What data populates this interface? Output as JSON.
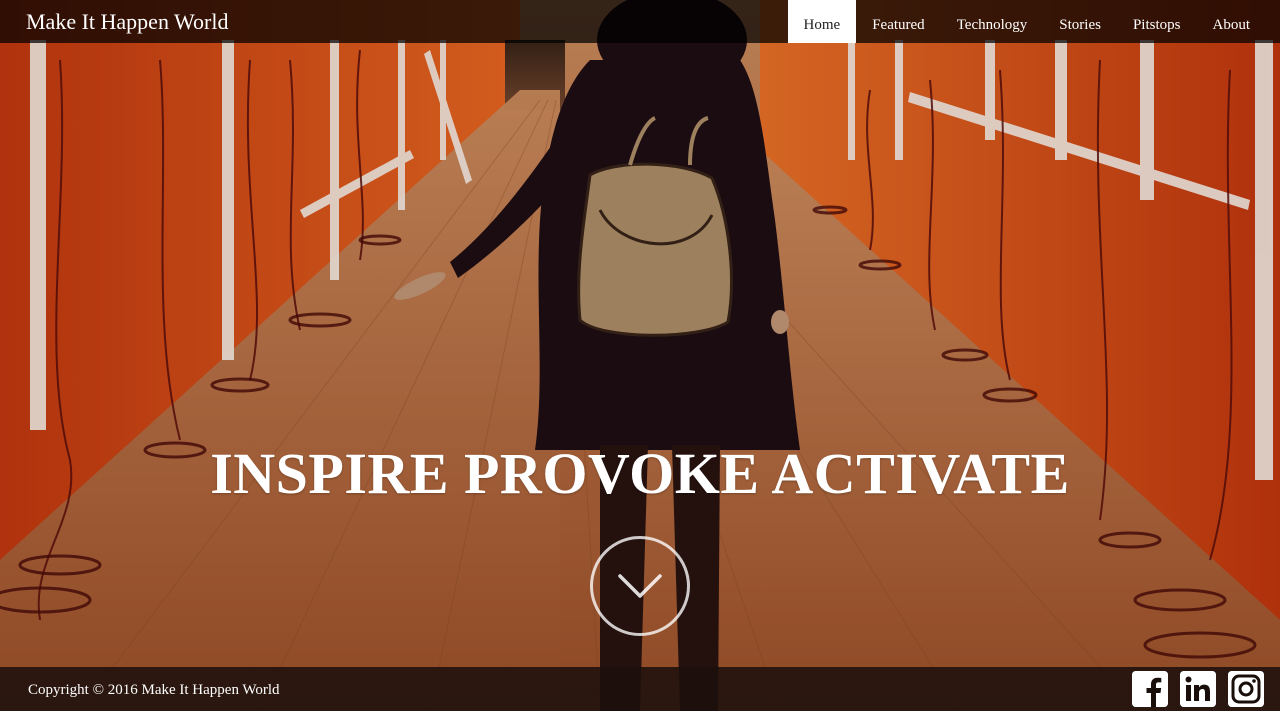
{
  "site": {
    "brand": "Make It Happen World"
  },
  "nav": {
    "items": [
      {
        "label": "Home",
        "active": true
      },
      {
        "label": "Featured",
        "active": false
      },
      {
        "label": "Technology",
        "active": false
      },
      {
        "label": "Stories",
        "active": false
      },
      {
        "label": "Pitstops",
        "active": false
      },
      {
        "label": "About",
        "active": false
      }
    ]
  },
  "hero": {
    "headline": "INSPIRE PROVOKE ACTIVATE",
    "scroll_icon": "chevron-down-icon"
  },
  "footer": {
    "copyright": "Copyright © 2016 Make It Happen World",
    "social": [
      {
        "icon": "facebook-icon"
      },
      {
        "icon": "linkedin-icon"
      },
      {
        "icon": "instagram-icon"
      }
    ]
  },
  "colors": {
    "nav_bg": "#000000",
    "active_tab_bg": "#ffffff",
    "wall_orange": "#e8551c",
    "floor_wood": "#b8703f"
  }
}
